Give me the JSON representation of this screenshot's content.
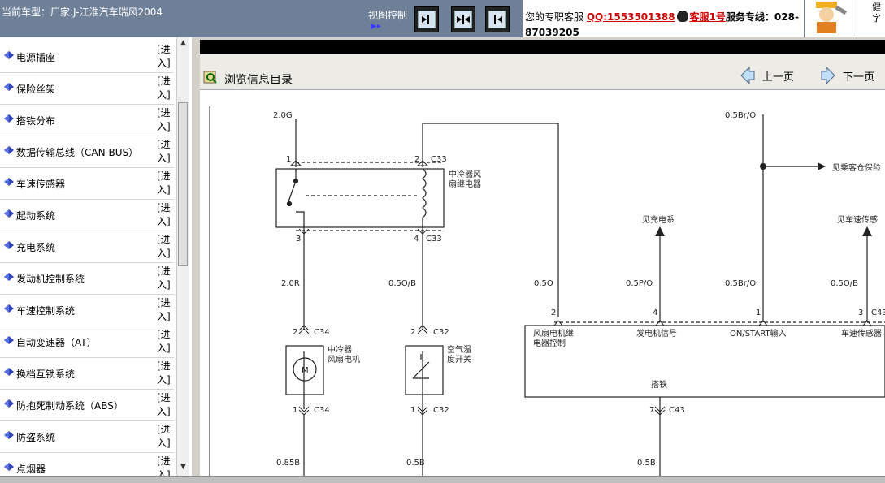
{
  "header": {
    "vehicle": "当前车型：厂家:J-江淮汽车瑞风2004",
    "view_control_label": "视图控制",
    "service_prefix": "您的专职客服",
    "qq": "QQ:1553501388",
    "kefu": "客服1号",
    "hotline_label": "服务专线：028-",
    "hotline_number": "87039205",
    "right_tab_line1": "健",
    "right_tab_line2": "字"
  },
  "sidebar": {
    "enter_label": "[进入]",
    "items": [
      {
        "label": "电源插座"
      },
      {
        "label": "保险丝架"
      },
      {
        "label": "搭铁分布"
      },
      {
        "label": "数据传输总线（CAN-BUS）"
      },
      {
        "label": "车速传感器"
      },
      {
        "label": "起动系统"
      },
      {
        "label": "充电系统"
      },
      {
        "label": "发动机控制系统"
      },
      {
        "label": "车速控制系统"
      },
      {
        "label": "自动变速器（AT）"
      },
      {
        "label": "换档互锁系统"
      },
      {
        "label": "防抱死制动系统（ABS）"
      },
      {
        "label": "防盗系统"
      },
      {
        "label": "点烟器"
      }
    ]
  },
  "toolbar": {
    "title": "浏览信息目录",
    "prev": "上一页",
    "next": "下一页"
  },
  "diagram": {
    "wire_top_left": "2.0G",
    "wire_top_right": "0.5Br/O",
    "pin1": "1",
    "pin2": "2",
    "c33": "C33",
    "relay_label_1": "中冷器风",
    "relay_label_2": "扇继电器",
    "pin3": "3",
    "pin4": "4",
    "c33b": "C33",
    "wire_2r": "2.0R",
    "wire_05ob": "0.5O/B",
    "wire_05o": "0.5O",
    "wire_05po": "0.5P/O",
    "wire_05bro": "0.5Br/O",
    "wire_05ob2": "0.5O/B",
    "to_charge": "见充电系",
    "to_speed": "见车速传感",
    "to_fuse": "见乘客仓保险",
    "c34_top_pin": "2",
    "c34_top": "C34",
    "c32_top_pin": "2",
    "c32_top": "C32",
    "motor_label_1": "中冷器",
    "motor_label_2": "风扇电机",
    "motor_symbol": "M",
    "switch_label_1": "空气温",
    "switch_label_2": "度开关",
    "ecm_pin2": "2",
    "ecm_pin4": "4",
    "ecm_pin1": "1",
    "ecm_pin3": "3",
    "ecm_conn": "C43",
    "ecm_in1_a": "风扇电机继",
    "ecm_in1_b": "电器控制",
    "ecm_in2": "发电机信号",
    "ecm_in3": "ON/START输入",
    "ecm_in4": "车速传感器",
    "ground": "搭铁",
    "c34_bot_pin": "1",
    "c34_bot": "C34",
    "c32_bot_pin": "1",
    "c32_bot": "C32",
    "c43_bot_pin": "7",
    "c43_bot": "C43",
    "wire_085b": "0.85B",
    "wire_05b": "0.5B",
    "wire_05b2": "0.5B"
  }
}
